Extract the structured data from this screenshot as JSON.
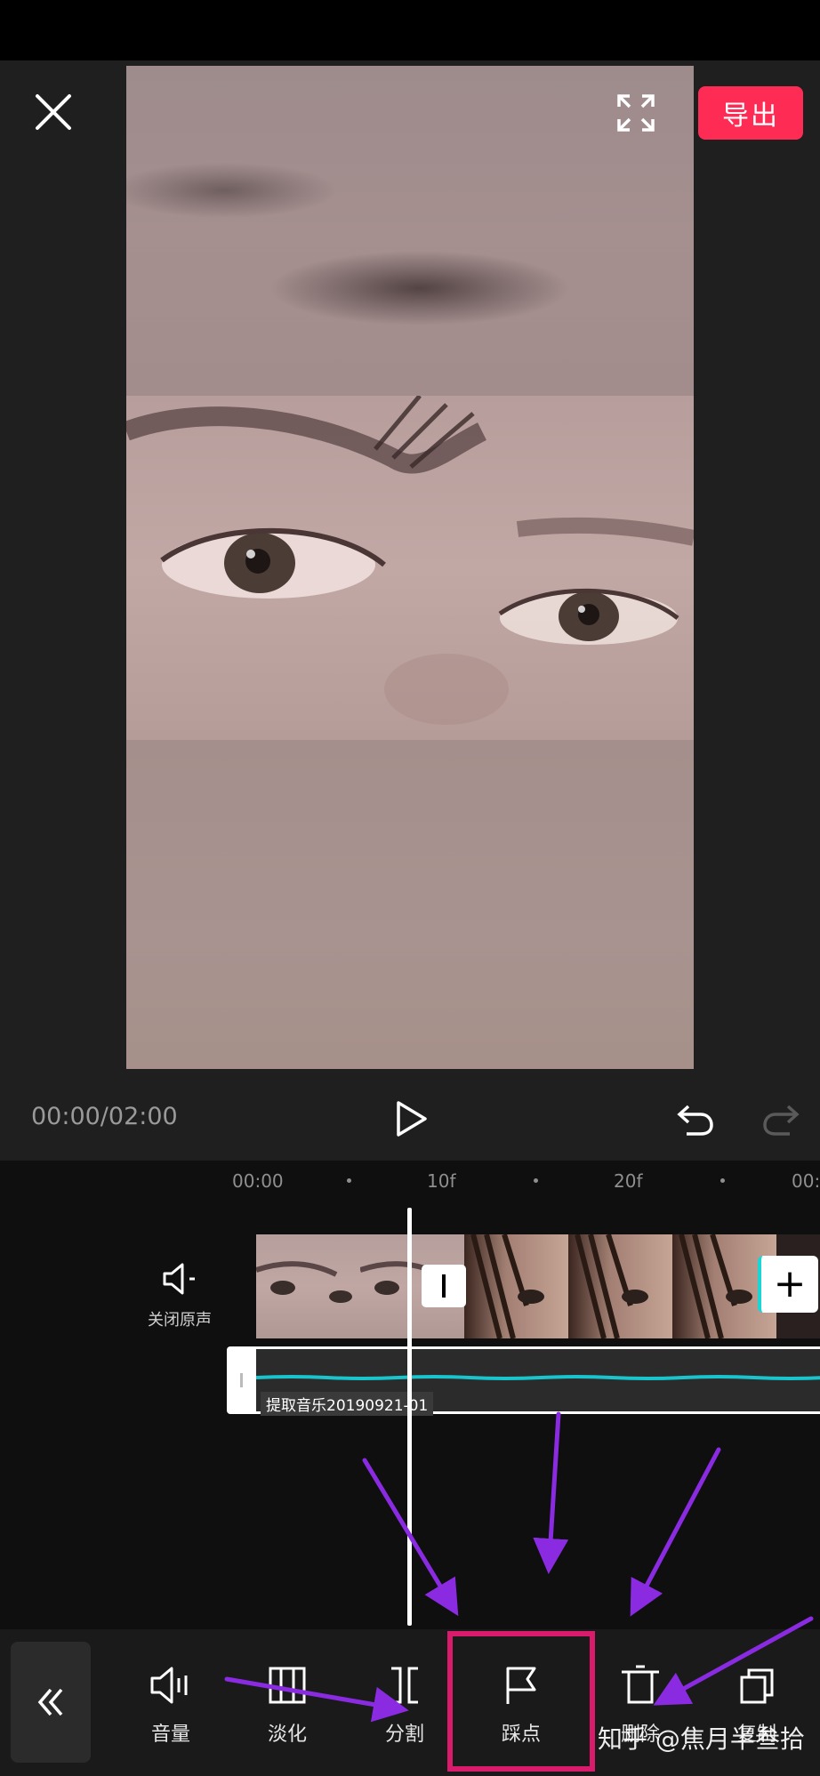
{
  "header": {
    "export_label": "导出",
    "close_icon": "close-icon",
    "fullscreen_icon": "fullscreen-icon"
  },
  "playback": {
    "time": "00:00/02:00",
    "play_icon": "play-icon",
    "undo_icon": "undo-icon",
    "redo_icon": "redo-icon"
  },
  "timeline": {
    "ruler": [
      "00:00",
      "10f",
      "20f",
      "00:"
    ],
    "mute_label": "关闭原声",
    "audio_label": "提取音乐20190921-01",
    "add_clip_label": "+"
  },
  "toolbar": {
    "back_icon": "double-chevron-left-icon",
    "tools": [
      {
        "label": "音量",
        "icon": "volume-icon"
      },
      {
        "label": "淡化",
        "icon": "fade-icon"
      },
      {
        "label": "分割",
        "icon": "split-icon"
      },
      {
        "label": "踩点",
        "icon": "flag-icon"
      },
      {
        "label": "删除",
        "icon": "delete-icon"
      },
      {
        "label": "复制",
        "icon": "copy-icon"
      }
    ]
  },
  "watermark": "知乎 @焦月半叁拾",
  "colors": {
    "accent": "#fe2c55",
    "highlight_box": "#d81b6b",
    "arrow": "#8a2be2",
    "waveform": "#19c4cc"
  }
}
